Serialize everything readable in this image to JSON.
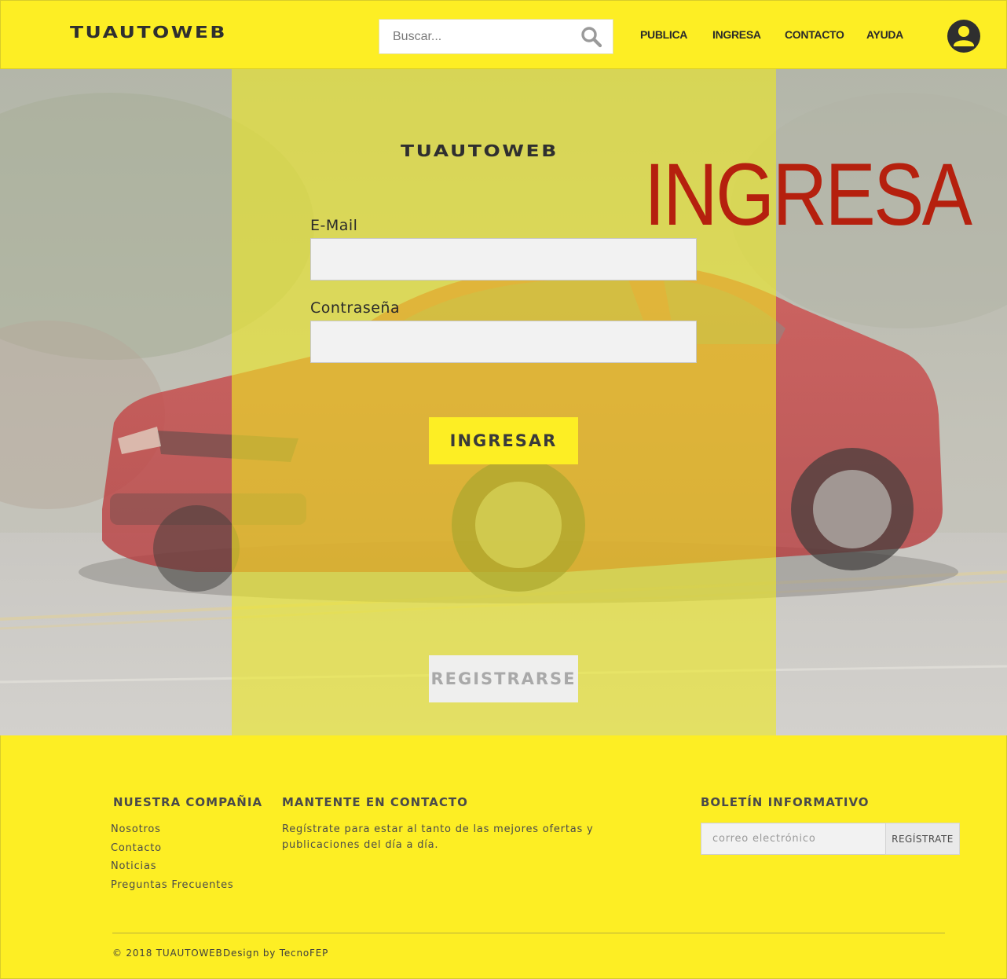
{
  "header": {
    "logo": "TUAUTOWEB",
    "search_placeholder": "Buscar...",
    "nav": [
      "PUBLICA",
      "INGRESA",
      "CONTACTO",
      "AYUDA"
    ]
  },
  "login": {
    "logo": "TUAUTOWEB",
    "title": "INGRESA",
    "email_label": "E-Mail",
    "password_label": "Contraseña",
    "submit_label": "INGRESAR",
    "register_label": "REGISTRARSE"
  },
  "footer": {
    "company": {
      "heading": "NUESTRA COMPAÑIA",
      "links": [
        "Nosotros",
        "Contacto",
        "Noticias",
        "Preguntas Frecuentes"
      ]
    },
    "contact": {
      "heading": "MANTENTE EN CONTACTO",
      "text": "Regístrate para estar al tanto de las mejores ofertas y publicaciones del día a día."
    },
    "newsletter": {
      "heading": "BOLETÍN INFORMATIVO",
      "placeholder": "correo electrónico",
      "button": "REGÍSTRATE"
    },
    "copyright": "© 2018 TUAUTOWEB",
    "credit": "Design by TecnoFEP"
  },
  "colors": {
    "brand_yellow": "#fdee24",
    "title_red": "#b5200e",
    "text_dark": "#2f2f2f"
  },
  "icons": {
    "search": "search-icon",
    "user": "user-icon"
  }
}
